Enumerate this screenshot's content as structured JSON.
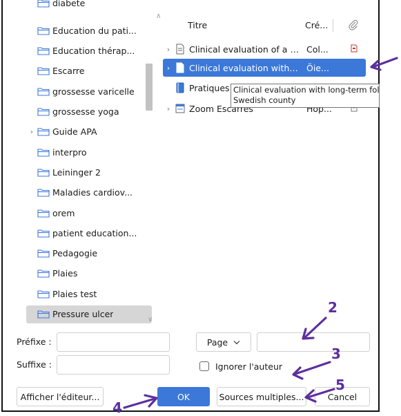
{
  "collections": [
    {
      "label": "diabete",
      "twisty": ""
    },
    {
      "label": "Education du pati...",
      "twisty": ""
    },
    {
      "label": "Education thérap...",
      "twisty": ""
    },
    {
      "label": "Escarre",
      "twisty": ""
    },
    {
      "label": "grossesse varicelle",
      "twisty": ""
    },
    {
      "label": "grossesse yoga",
      "twisty": ""
    },
    {
      "label": "Guide APA",
      "twisty": "›"
    },
    {
      "label": "interpro",
      "twisty": ""
    },
    {
      "label": "Leininger 2",
      "twisty": ""
    },
    {
      "label": "Maladies cardiov...",
      "twisty": ""
    },
    {
      "label": "orem",
      "twisty": ""
    },
    {
      "label": "patient education...",
      "twisty": ""
    },
    {
      "label": "Pedagogie",
      "twisty": ""
    },
    {
      "label": "Plaies",
      "twisty": ""
    },
    {
      "label": "Plaies test",
      "twisty": ""
    },
    {
      "label": "Pressure ulcer",
      "twisty": "",
      "selected": true
    }
  ],
  "items_table": {
    "col_title": "Titre",
    "col_creator": "Cré...",
    "attachment_icon": "paperclip-icon",
    "rows": [
      {
        "title": "Clinical evaluation of a ne...",
        "creator": "Col...",
        "attachment": "pdf-icon",
        "twisty": "›",
        "icon": "document-icon"
      },
      {
        "title": "Clinical evaluation with lo...",
        "creator": "Öie...",
        "attachment": "",
        "twisty": "›",
        "icon": "document-icon",
        "selected": true
      },
      {
        "title": "Pratiques",
        "creator": "",
        "attachment": "",
        "twisty": "",
        "icon": "book-icon"
      },
      {
        "title": "Zoom Escarres",
        "creator": "Hop...",
        "attachment": "snapshot-icon",
        "twisty": "›",
        "icon": "webpage-icon"
      }
    ]
  },
  "tooltip": {
    "line1": "Clinical evaluation with long-term foll",
    "line2": "Swedish county"
  },
  "form": {
    "prefix_label": "Préfixe :",
    "prefix_value": "",
    "suffix_label": "Suffixe :",
    "suffix_value": "",
    "locator_select": "Page",
    "locator_value": "",
    "omit_author_label": "Ignorer l'auteur",
    "omit_author_checked": false
  },
  "buttons": {
    "show_editor": "Afficher l'éditeur...",
    "ok": "OK",
    "multiple_sources": "Sources multiples...",
    "cancel": "Cancel"
  },
  "annotations": {
    "color": "#5c2f9e",
    "labels": [
      "2",
      "3",
      "4",
      "5"
    ]
  },
  "colors": {
    "accent": "#3b78d8",
    "selected_collection": "#d6d6d6"
  }
}
